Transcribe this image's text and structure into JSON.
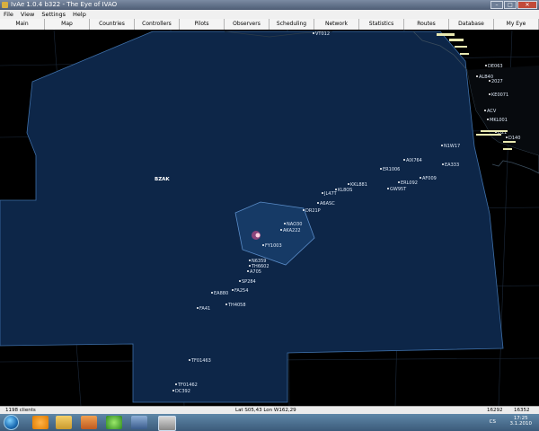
{
  "window": {
    "title": "IvAe 1.0.4 b322 - The Eye of IVAO"
  },
  "menu": [
    "File",
    "View",
    "Settings",
    "Help"
  ],
  "tabs": [
    "Main",
    "Map",
    "Countries",
    "Controllers",
    "Pilots",
    "Observers",
    "Scheduling",
    "Network",
    "Statistics",
    "Routes",
    "Database",
    "My Eye"
  ],
  "map": {
    "region_label": "BZAK",
    "aircraft": [
      {
        "label": "VT012"
      },
      {
        "label": "DE063"
      },
      {
        "label": "ALB40"
      },
      {
        "label": "2027"
      },
      {
        "label": "KE0071"
      },
      {
        "label": "ACV"
      },
      {
        "label": "MKL001"
      },
      {
        "label": "D21"
      },
      {
        "label": "D140"
      },
      {
        "label": "N1W17"
      },
      {
        "label": "EA333"
      },
      {
        "label": "AIX764"
      },
      {
        "label": "ER1006"
      },
      {
        "label": "KKL881"
      },
      {
        "label": "KL8OS"
      },
      {
        "label": "JL47T"
      },
      {
        "label": "A6ASC"
      },
      {
        "label": "ERL092"
      },
      {
        "label": "AF009"
      },
      {
        "label": "GW95T"
      },
      {
        "label": "DR21P"
      },
      {
        "label": "NAO30"
      },
      {
        "label": "AKA222"
      },
      {
        "label": "FY1003"
      },
      {
        "label": "N6359"
      },
      {
        "label": "TH6602"
      },
      {
        "label": "A705"
      },
      {
        "label": "SP284"
      },
      {
        "label": "FA254"
      },
      {
        "label": "EA880"
      },
      {
        "label": "TH4058"
      },
      {
        "label": "FA41"
      },
      {
        "label": "TF01463"
      },
      {
        "label": "TF01462"
      },
      {
        "label": "DC392"
      }
    ]
  },
  "status": {
    "clients": "1198 clients",
    "coords": "Lat S05,43 Lon W162,29",
    "time_local": "16292",
    "time_utc": "16352"
  },
  "taskbar": {
    "lang": "CS",
    "clock_time": "17:25",
    "clock_date": "3.1.2010"
  }
}
